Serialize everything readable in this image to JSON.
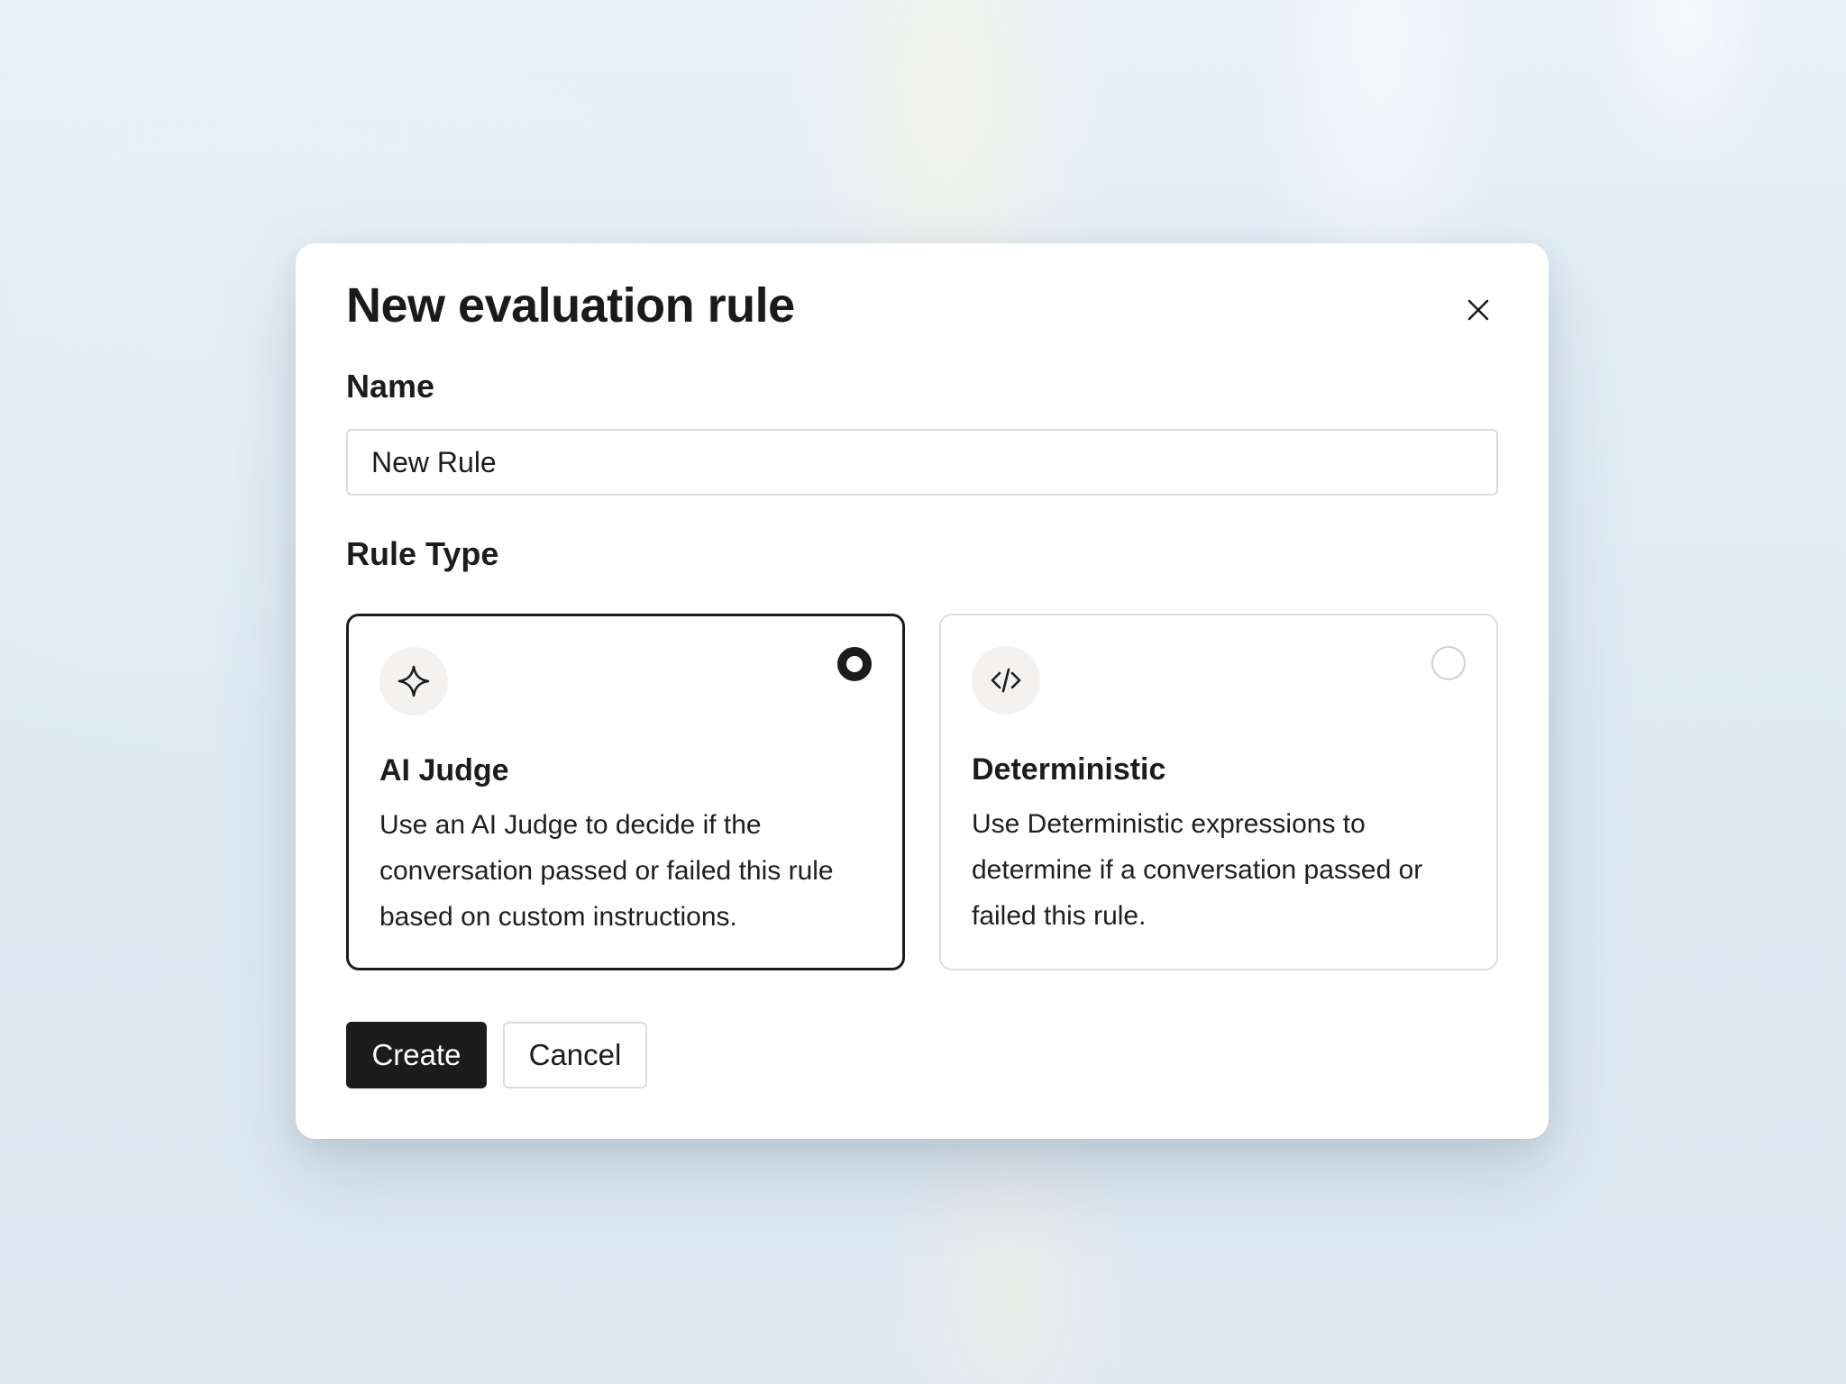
{
  "dialog": {
    "title": "New evaluation rule",
    "close_icon": "close-icon"
  },
  "name_field": {
    "label": "Name",
    "value": "New Rule"
  },
  "rule_type": {
    "label": "Rule Type",
    "selected": "AI Judge",
    "options": [
      {
        "title": "AI Judge",
        "description": "Use an AI Judge to decide if the conversation passed or failed this rule based on custom instructions.",
        "icon": "sparkle-icon",
        "selected": true
      },
      {
        "title": "Deterministic",
        "description": "Use Deterministic expressions to determine if a conversation passed or failed this rule.",
        "icon": "code-icon",
        "selected": false
      }
    ]
  },
  "actions": {
    "create_label": "Create",
    "cancel_label": "Cancel"
  },
  "colors": {
    "accent": "#1c1c1c",
    "border": "#dcdcdc",
    "icon_bg": "#f3f2f0",
    "background": "#e6eff6"
  }
}
